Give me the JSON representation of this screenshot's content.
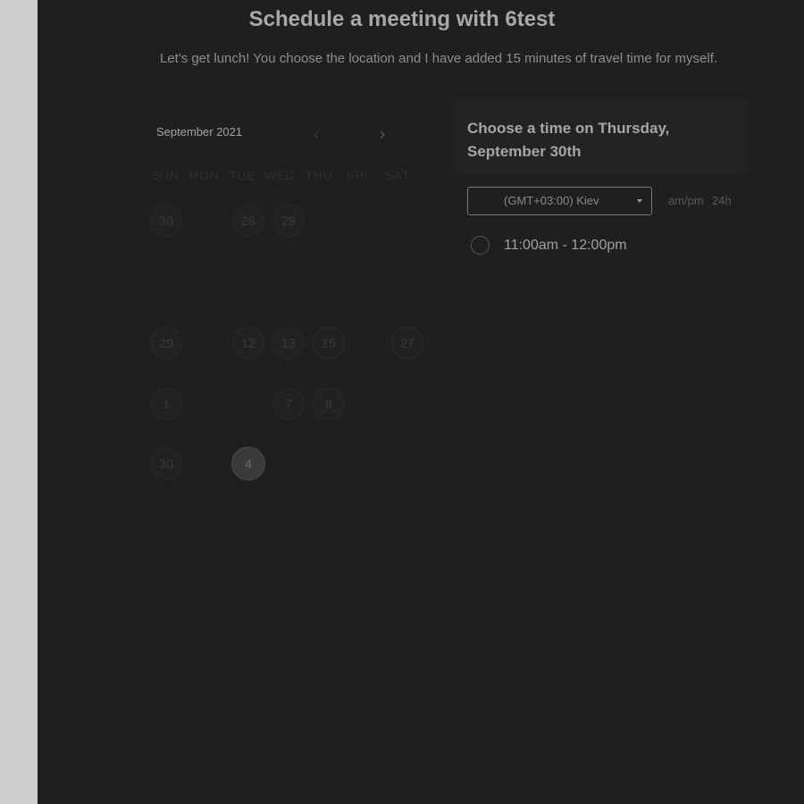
{
  "header": {
    "title": "Schedule a meeting with 6test",
    "description": "Let's get lunch! You choose the location and I have added 15 minutes of travel time for myself."
  },
  "calendar": {
    "month_label": "September 2021",
    "prev_icon": "‹",
    "next_icon": "›",
    "weekdays": [
      "SUN",
      "MON",
      "TUE",
      "WED",
      "THU",
      "FRI",
      "SAT"
    ],
    "days": [
      "30",
      "28",
      "29",
      "29",
      "12",
      "13",
      "15",
      "27",
      "1",
      "7",
      "8",
      "30",
      "4"
    ],
    "selected_day": "4"
  },
  "times_panel": {
    "heading": "Choose a time on Thursday, September 30th",
    "timezone": "(GMT+03:00) Kiev",
    "format_ampm": "am/pm",
    "format_24h": "24h",
    "slots": [
      {
        "label": "11:00am - 12:00pm"
      }
    ]
  }
}
